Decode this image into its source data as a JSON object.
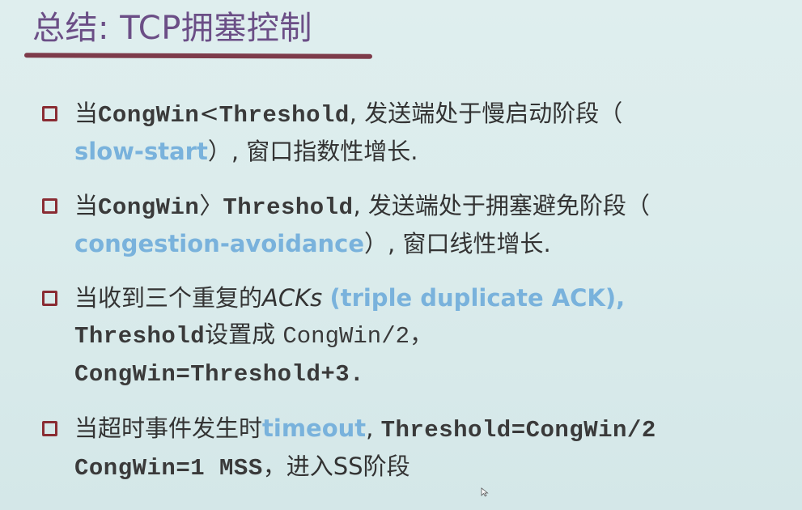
{
  "title": "总结: TCP拥塞控制",
  "bullets": [
    {
      "p1": "当",
      "p2": "CongWin",
      "p3": "<",
      "p4": "Threshold",
      "p5": ", 发送端处于慢启动阶段（",
      "p6": "slow-start",
      "p7": "）, 窗口指数性增长."
    },
    {
      "p1": "当",
      "p2": "CongWin",
      "p3": "〉",
      "p4": "Threshold",
      "p5": ", 发送端处于拥塞避免阶段（",
      "p6": "congestion-avoidance",
      "p7": "）, 窗口线性增长."
    },
    {
      "p1": "当收到三个重复的",
      "p2": "ACKs",
      "p3": "(triple duplicate ACK),",
      "p4": "Threshold",
      "p5": "设置成",
      "p6": "CongWin/2，",
      "p7": "CongWin=Threshold+3."
    },
    {
      "p1": "当超时事件发生时",
      "p2": "timeout",
      "p3": ", ",
      "p4": "Threshold=CongWin/2",
      "p5": "CongWin=1 MSS",
      "p6": "，进入SS阶段"
    }
  ],
  "colors": {
    "title": "#6b4e86",
    "rule": "#7d3b4a",
    "bullet_box": "#8a2c33",
    "accent": "#79b2dc",
    "body_text": "#333333",
    "background": "#dbecec"
  },
  "icons": {
    "bullet": "square-outline-icon",
    "cursor": "mouse-pointer-icon"
  }
}
